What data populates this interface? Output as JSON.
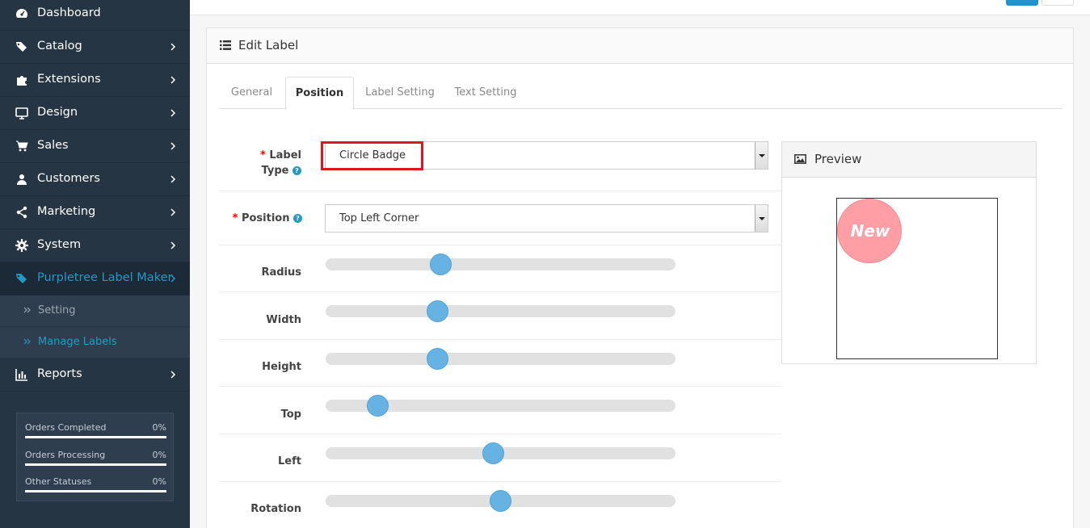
{
  "sidebar": {
    "items": [
      {
        "label": "Dashboard",
        "icon": "dashboard-icon"
      },
      {
        "label": "Catalog",
        "icon": "tags-icon"
      },
      {
        "label": "Extensions",
        "icon": "puzzle-icon"
      },
      {
        "label": "Design",
        "icon": "monitor-icon"
      },
      {
        "label": "Sales",
        "icon": "cart-icon"
      },
      {
        "label": "Customers",
        "icon": "user-icon"
      },
      {
        "label": "Marketing",
        "icon": "share-icon"
      },
      {
        "label": "System",
        "icon": "gear-icon"
      },
      {
        "label": "Purpletree Label Maker",
        "icon": "tag-icon"
      },
      {
        "label": "Reports",
        "icon": "bar-chart-icon"
      }
    ],
    "subitems": [
      {
        "label": "Setting"
      },
      {
        "label": "Manage Labels"
      }
    ],
    "stats": [
      {
        "name": "Orders Completed",
        "pct": "0%"
      },
      {
        "name": "Orders Processing",
        "pct": "0%"
      },
      {
        "name": "Other Statuses",
        "pct": "0%"
      }
    ]
  },
  "colors": {
    "sidebar_bg": "#263544",
    "accent": "#229ac8",
    "slider": "#66b3e3",
    "badge": "#ff9ea4",
    "required": "#ff0000"
  },
  "panel": {
    "title": "Edit Label",
    "tabs": [
      "General",
      "Position",
      "Label Setting",
      "Text Setting"
    ],
    "active_tab": "Position"
  },
  "form": {
    "label_type": {
      "label": "Label Type",
      "required": "*",
      "value": "Circle Badge"
    },
    "position": {
      "label": "Position",
      "required": "*",
      "value": "Top Left Corner"
    },
    "sliders": [
      {
        "label": "Radius",
        "value": 0.33
      },
      {
        "label": "Width",
        "value": 0.32
      },
      {
        "label": "Height",
        "value": 0.32
      },
      {
        "label": "Top",
        "value": 0.15
      },
      {
        "label": "Left",
        "value": 0.48
      },
      {
        "label": "Rotation",
        "value": 0.5
      }
    ]
  },
  "preview": {
    "title": "Preview",
    "badge_text": "New"
  }
}
